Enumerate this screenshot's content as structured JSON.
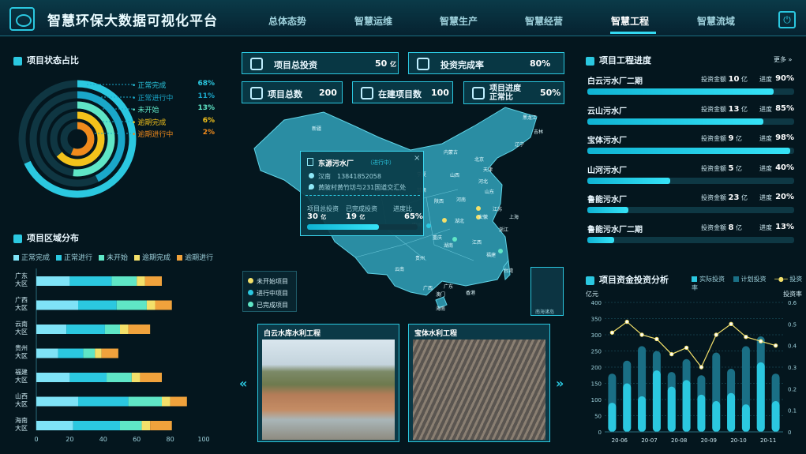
{
  "app_title": "智慧环保大数据可视化平台",
  "nav": [
    "总体态势",
    "智慧运维",
    "智慧生产",
    "智慧经营",
    "智慧工程",
    "智慧流域"
  ],
  "nav_active": "智慧工程",
  "status_section": {
    "title": "项目状态占比",
    "items": [
      {
        "label": "正常完成",
        "pct": "68%",
        "color": "#2bc8e0"
      },
      {
        "label": "正常进行中",
        "pct": "11%",
        "color": "#1aa7c9"
      },
      {
        "label": "未开始",
        "pct": "13%",
        "color": "#5fe6c6"
      },
      {
        "label": "逾期完成",
        "pct": "6%",
        "color": "#f3c21b"
      },
      {
        "label": "逾期进行中",
        "pct": "2%",
        "color": "#f08a1c"
      }
    ]
  },
  "region_section": {
    "title": "项目区域分布",
    "legend": [
      "正常完成",
      "正常进行",
      "未开始",
      "逾期完成",
      "逾期进行"
    ],
    "legend_colors": [
      "#7fe3f7",
      "#2bc8e0",
      "#5fe6c6",
      "#f3e06a",
      "#f0a23c"
    ],
    "rows": [
      {
        "l1": "广东",
        "l2": "大区",
        "vals": [
          20,
          25,
          15,
          5,
          10
        ]
      },
      {
        "l1": "广西",
        "l2": "大区",
        "vals": [
          25,
          23,
          18,
          5,
          10
        ]
      },
      {
        "l1": "云南",
        "l2": "大区",
        "vals": [
          18,
          23,
          9,
          5,
          13
        ]
      },
      {
        "l1": "贵州",
        "l2": "大区",
        "vals": [
          13,
          15,
          7,
          4,
          10
        ]
      },
      {
        "l1": "福建",
        "l2": "大区",
        "vals": [
          20,
          22,
          15,
          5,
          13
        ]
      },
      {
        "l1": "山西",
        "l2": "大区",
        "vals": [
          25,
          30,
          20,
          5,
          10
        ]
      },
      {
        "l1": "海南",
        "l2": "大区",
        "vals": [
          22,
          28,
          13,
          5,
          13
        ]
      }
    ],
    "axis": [
      "0",
      "20",
      "40",
      "60",
      "80",
      "100"
    ]
  },
  "kpis": [
    {
      "label": "项目总投资",
      "value": "50",
      "unit": "亿"
    },
    {
      "label": "投资完成率",
      "value": "80%",
      "unit": ""
    },
    {
      "label": "项目总数",
      "value": "200",
      "unit": ""
    },
    {
      "label": "在建项目数",
      "value": "100",
      "unit": ""
    },
    {
      "label": "项目进度正常比",
      "value": "50%",
      "unit": ""
    }
  ],
  "map": {
    "provinces": [
      "新疆",
      "内蒙古",
      "黑龙江",
      "吉林",
      "辽宁",
      "北京",
      "天津",
      "河北",
      "山西",
      "宁夏",
      "青海",
      "甘肃",
      "陕西",
      "河南",
      "山东",
      "江苏",
      "安徽",
      "上海",
      "湖北",
      "四川",
      "重庆",
      "浙江",
      "湖南",
      "江西",
      "福建",
      "贵州",
      "云南",
      "广西",
      "广东",
      "澳门",
      "香港",
      "海南",
      "台湾"
    ],
    "south_sea": "南海诸岛",
    "legend": [
      {
        "label": "未开始项目",
        "color": "#f3e06a"
      },
      {
        "label": "进行中项目",
        "color": "#2bc8e0"
      },
      {
        "label": "已完成项目",
        "color": "#5fe6c6"
      }
    ]
  },
  "popup": {
    "name": "东源污水厂",
    "status": "进行中",
    "city": "汉南",
    "phone": "13841852058",
    "address": "黄陂村黄竹坊与231国道交汇处",
    "metrics": [
      {
        "label": "项目总投资",
        "value": "30",
        "unit": "亿"
      },
      {
        "label": "已完成投资",
        "value": "19",
        "unit": "亿"
      },
      {
        "label": "进度比",
        "value": "65%",
        "unit": ""
      }
    ],
    "progress": 0.65
  },
  "photos": [
    {
      "title": "白云水库水利工程"
    },
    {
      "title": "宝体水利工程"
    }
  ],
  "progress_section": {
    "title": "项目工程进度",
    "more": "更多",
    "items": [
      {
        "name": "白云污水厂二期",
        "invest_label": "投资金额",
        "invest": "10",
        "unit": "亿",
        "prog_label": "进度",
        "pct": "90%",
        "val": 0.9
      },
      {
        "name": "云山污水厂",
        "invest_label": "投资金额",
        "invest": "13",
        "unit": "亿",
        "prog_label": "进度",
        "pct": "85%",
        "val": 0.85
      },
      {
        "name": "宝体污水厂",
        "invest_label": "投资金额",
        "invest": "9",
        "unit": "亿",
        "prog_label": "进度",
        "pct": "98%",
        "val": 0.98
      },
      {
        "name": "山河污水厂",
        "invest_label": "投资金额",
        "invest": "5",
        "unit": "亿",
        "prog_label": "进度",
        "pct": "40%",
        "val": 0.4
      },
      {
        "name": "鲁能污水厂",
        "invest_label": "投资金额",
        "invest": "23",
        "unit": "亿",
        "prog_label": "进度",
        "pct": "20%",
        "val": 0.2
      },
      {
        "name": "鲁能污水厂二期",
        "invest_label": "投资金额",
        "invest": "8",
        "unit": "亿",
        "prog_label": "进度",
        "pct": "13%",
        "val": 0.13
      }
    ]
  },
  "invest_section": {
    "title": "项目资金投资分析",
    "legend": [
      "实际投资",
      "计划投资",
      "投资率"
    ]
  },
  "chart_data": {
    "type": "bar",
    "categories": [
      "20-06",
      "20-07",
      "20-08",
      "20-09",
      "20-10",
      "20-11"
    ],
    "series": [
      {
        "name": "实际投资",
        "values": [
          90,
          150,
          110,
          190,
          140,
          160,
          115,
          95,
          120,
          85,
          215,
          95
        ]
      },
      {
        "name": "计划投资",
        "values": [
          180,
          220,
          265,
          250,
          185,
          225,
          175,
          245,
          195,
          265,
          295,
          180
        ]
      },
      {
        "name": "投资率",
        "values": [
          0.46,
          0.51,
          0.45,
          0.43,
          0.36,
          0.39,
          0.3,
          0.45,
          0.5,
          0.44,
          0.42,
          0.4
        ]
      }
    ],
    "ylabel": "亿元",
    "y2label": "投资率",
    "ylim": [
      0,
      400
    ],
    "y2lim": [
      0,
      0.6
    ],
    "yticks": [
      "0",
      "50",
      "100",
      "150",
      "200",
      "250",
      "300",
      "350",
      "400"
    ],
    "y2ticks": [
      "0",
      "0.1",
      "0.2",
      "0.3",
      "0.4",
      "0.5",
      "0.6"
    ]
  }
}
